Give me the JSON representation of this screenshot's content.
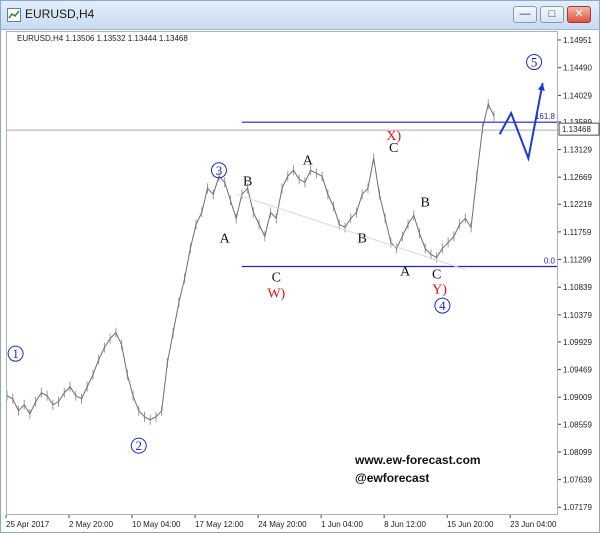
{
  "window": {
    "title": "EURUSD,H4"
  },
  "chart_data": {
    "type": "line",
    "symbol_line": "EURUSD,H4  1.13506 1.13532 1.13444 1.13468",
    "current_price": "1.13468",
    "current_price_value": 1.13468,
    "y_ticks": [
      1.14951,
      1.1449,
      1.14029,
      1.13589,
      1.13129,
      1.12669,
      1.12219,
      1.11759,
      1.11299,
      1.10839,
      1.10379,
      1.09929,
      1.09469,
      1.09009,
      1.08559,
      1.08099,
      1.07639,
      1.07179
    ],
    "y_tick_labels": [
      "1.14951",
      "1.14490",
      "1.14029",
      "1.13589",
      "1.13129",
      "1.12669",
      "1.12219",
      "1.11759",
      "1.11299",
      "1.10839",
      "1.10379",
      "1.09929",
      "1.09469",
      "1.09009",
      "1.08559",
      "1.08099",
      "1.07639",
      "1.07179"
    ],
    "ylim": [
      1.0705,
      1.151
    ],
    "xlim": [
      0,
      96
    ],
    "x_ticks": [
      0,
      11,
      22,
      33,
      44,
      55,
      66,
      77,
      88
    ],
    "x_tick_labels": [
      "25 Apr 2017",
      "2 May 20:00",
      "10 May 04:00",
      "17 May 12:00",
      "24 May 20:00",
      "1 Jun 04:00",
      "8 Jun 12:00",
      "15 Jun 20:00",
      "23 Jun 04:00"
    ],
    "close_series": [
      1.0905,
      1.09,
      1.088,
      1.089,
      1.0875,
      1.0895,
      1.091,
      1.0905,
      1.089,
      1.0895,
      1.091,
      1.092,
      1.0905,
      1.09,
      1.092,
      1.094,
      1.0965,
      1.0985,
      1.1,
      1.101,
      1.099,
      1.094,
      1.0905,
      1.088,
      1.087,
      1.0865,
      1.087,
      1.088,
      1.096,
      1.101,
      1.106,
      1.11,
      1.115,
      1.119,
      1.121,
      1.125,
      1.124,
      1.127,
      1.126,
      1.123,
      1.12,
      1.124,
      1.125,
      1.121,
      1.119,
      1.117,
      1.121,
      1.12,
      1.125,
      1.127,
      1.128,
      1.1265,
      1.126,
      1.128,
      1.1275,
      1.127,
      1.124,
      1.122,
      1.119,
      1.1185,
      1.12,
      1.121,
      1.124,
      1.125,
      1.13,
      1.124,
      1.12,
      1.116,
      1.115,
      1.117,
      1.119,
      1.1205,
      1.1175,
      1.115,
      1.114,
      1.1135,
      1.115,
      1.116,
      1.117,
      1.119,
      1.12,
      1.1185,
      1.127,
      1.135,
      1.139,
      1.137
    ],
    "levels": [
      {
        "label": "161.8",
        "value": 1.136,
        "x_from": 41,
        "x_to": 96
      },
      {
        "label": "0.0",
        "value": 1.112,
        "x_from": 41,
        "x_to": 96
      }
    ],
    "trendline": {
      "from": {
        "x": 40,
        "y": 1.124
      },
      "to": {
        "x": 80,
        "y": 1.1115
      }
    },
    "projection": [
      {
        "x": 86,
        "y": 1.134
      },
      {
        "x": 88,
        "y": 1.1375
      },
      {
        "x": 91,
        "y": 1.13
      },
      {
        "x": 93.5,
        "y": 1.1425
      }
    ],
    "annotations": [
      {
        "text": "1",
        "style": "circle-blue",
        "x": 1.5,
        "y": 1.0975
      },
      {
        "text": "2",
        "style": "circle-blue",
        "x": 23,
        "y": 1.0822
      },
      {
        "text": "3",
        "style": "circle-blue",
        "x": 37,
        "y": 1.128
      },
      {
        "text": "4",
        "style": "circle-blue",
        "x": 76,
        "y": 1.1055
      },
      {
        "text": "5",
        "style": "circle-blue",
        "x": 92,
        "y": 1.146
      },
      {
        "text": "A",
        "style": "black",
        "x": 38,
        "y": 1.116
      },
      {
        "text": "B",
        "style": "black",
        "x": 42,
        "y": 1.1255
      },
      {
        "text": "C",
        "style": "black",
        "x": 47,
        "y": 1.1095
      },
      {
        "text": "W)",
        "style": "red",
        "x": 47,
        "y": 1.1068
      },
      {
        "text": "A",
        "style": "black",
        "x": 52.5,
        "y": 1.129
      },
      {
        "text": "B",
        "style": "black",
        "x": 62,
        "y": 1.116
      },
      {
        "text": "C",
        "style": "black",
        "x": 67.5,
        "y": 1.131
      },
      {
        "text": "X)",
        "style": "red",
        "x": 67.5,
        "y": 1.133
      },
      {
        "text": "A",
        "style": "black",
        "x": 69.5,
        "y": 1.1105
      },
      {
        "text": "B",
        "style": "black",
        "x": 73,
        "y": 1.122
      },
      {
        "text": "C",
        "style": "black",
        "x": 75,
        "y": 1.11
      },
      {
        "text": "Y)",
        "style": "red",
        "x": 75.5,
        "y": 1.1075
      }
    ],
    "watermark": [
      "www.ew-forecast.com",
      "@ewforecast"
    ]
  }
}
